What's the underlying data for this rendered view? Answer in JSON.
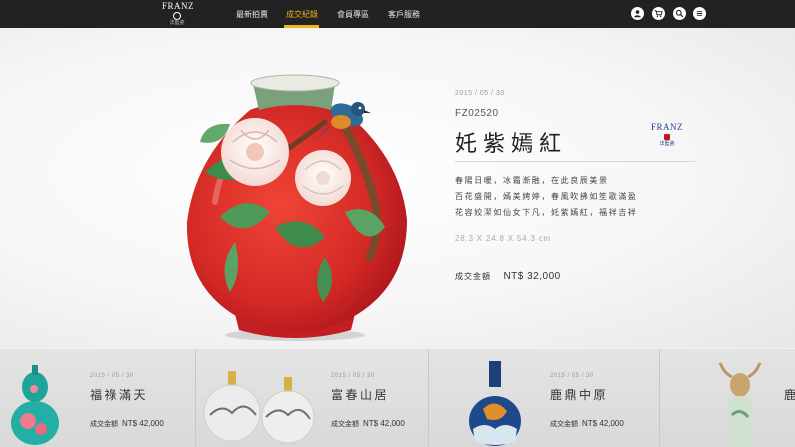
{
  "header": {
    "logo_text": "FRANZ",
    "logo_subtext": "法藍瓷",
    "nav": [
      {
        "label": "最新拍賣",
        "active": false
      },
      {
        "label": "成交紀錄",
        "active": true
      },
      {
        "label": "會員專區",
        "active": false
      },
      {
        "label": "客戶服務",
        "active": false
      }
    ],
    "icons": [
      "user-icon",
      "cart-icon",
      "search-icon",
      "menu-icon"
    ],
    "accent_color": "#f2b21a"
  },
  "featured": {
    "date": "2015 / 05 / 30",
    "code": "FZ02520",
    "title": "奼紫嫣紅",
    "brand_text": "FRANZ",
    "brand_subtext": "法藍瓷",
    "description": [
      "春陽日暖，冰霜漸融，在此良辰美景",
      "百花盛開，嫣美娉婷，春風吹拂如笙歌滿盈",
      "花容姣潔如仙女下凡，奼紫嫣紅，福祥吉祥"
    ],
    "dimensions": "28.3 X 24.8 X 54.3 cm",
    "price_label": "成交金額",
    "price_value": "NT$ 32,000",
    "vase_color": "#d42a26"
  },
  "cards": [
    {
      "date": "2015 / 05 / 30",
      "title": "福祿滿天",
      "price_label": "成交金額",
      "price_value": "NT$ 42,000"
    },
    {
      "date": "2015 / 05 / 30",
      "title": "富春山居",
      "price_label": "成交金額",
      "price_value": "NT$ 42,000"
    },
    {
      "date": "2015 / 05 / 30",
      "title": "鹿鼎中原",
      "price_label": "成交金額",
      "price_value": "NT$ 42,000"
    },
    {
      "date": "",
      "title": "鹿",
      "price_label": "",
      "price_value": ""
    }
  ]
}
